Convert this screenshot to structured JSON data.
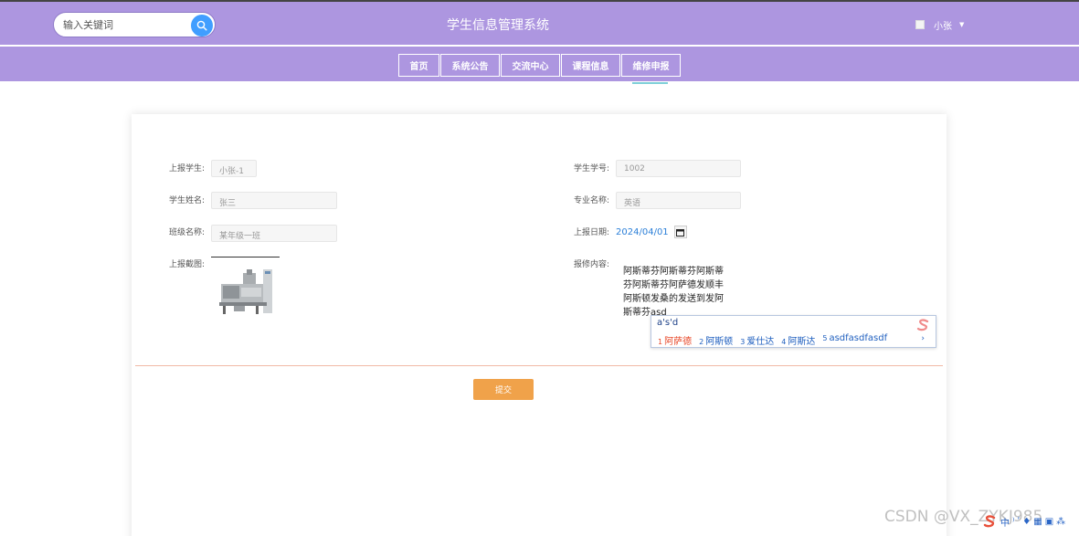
{
  "header": {
    "search": {
      "placeholder": "输入关键词"
    },
    "title": "学生信息管理系统",
    "user": {
      "name": "小张"
    }
  },
  "nav": {
    "items": [
      {
        "label": "首页"
      },
      {
        "label": "系统公告"
      },
      {
        "label": "交流中心"
      },
      {
        "label": "课程信息"
      },
      {
        "label": "维修申报"
      }
    ],
    "active_index": 4
  },
  "form": {
    "reporter": {
      "label": "上报学生:",
      "value": "小张-1"
    },
    "student_id": {
      "label": "学生学号:",
      "value": "1002"
    },
    "student_name": {
      "label": "学生姓名:",
      "value": "张三"
    },
    "major": {
      "label": "专业名称:",
      "value": "英语"
    },
    "class_name": {
      "label": "班级名称:",
      "value": "某年级一班"
    },
    "report_date": {
      "label": "上报日期:",
      "year": "2024",
      "month": "04",
      "day": "01"
    },
    "screenshot": {
      "label": "上报截图:"
    },
    "content": {
      "label": "报修内容:",
      "lines": [
        "阿斯蒂芬阿斯蒂芬阿斯蒂",
        "芬阿斯蒂芬阿萨德发顺丰",
        "阿斯顿发桑的发送到发阿",
        "斯蒂芬asd"
      ]
    },
    "submit_label": "提交"
  },
  "ime": {
    "composition": "a's'd",
    "candidates": [
      {
        "num": "1",
        "text": "阿萨德"
      },
      {
        "num": "2",
        "text": "阿斯顿"
      },
      {
        "num": "3",
        "text": "爱仕达"
      },
      {
        "num": "4",
        "text": "阿斯达"
      },
      {
        "num": "5",
        "text": "asdfasdfasdf"
      }
    ],
    "more": "›",
    "toolbar": [
      "中",
      "⁾",
      "ʹ",
      "♦",
      "▦",
      "▣",
      "⁂"
    ]
  },
  "watermark": "CSDN @VX_ZYKJ985",
  "colors": {
    "header": "#ad96e0",
    "submit": "#f0a24a",
    "accent_blue": "#409eff",
    "divider": "#f1b9a6"
  }
}
